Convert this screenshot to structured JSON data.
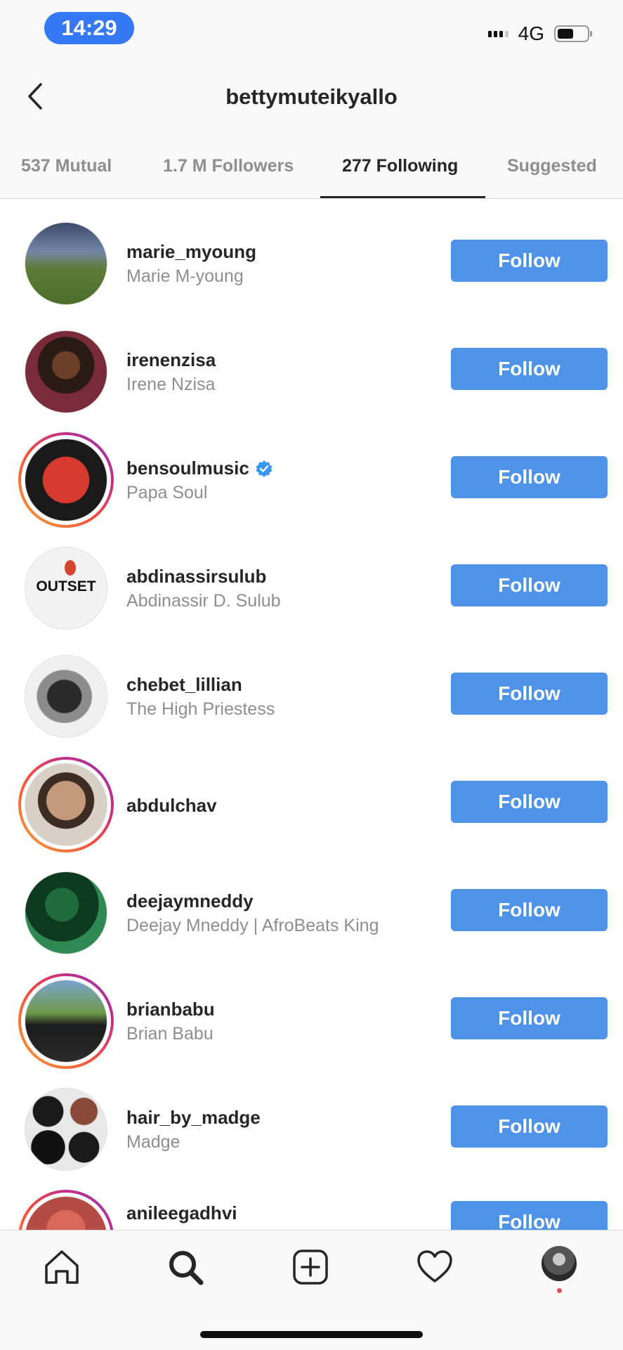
{
  "status_bar": {
    "time": "14:29",
    "network": "4G"
  },
  "header": {
    "title": "bettymuteikyallo"
  },
  "tabs": [
    {
      "label": "537 Mutual"
    },
    {
      "label": "1.7 M Followers"
    },
    {
      "label": "277 Following"
    },
    {
      "label": "Suggested"
    }
  ],
  "follow_label": "Follow",
  "accounts": [
    {
      "handle": "marie_myoung",
      "name": "Marie M-young",
      "verified": false,
      "story_ring": false
    },
    {
      "handle": "irenenzisa",
      "name": "Irene Nzisa",
      "verified": false,
      "story_ring": false
    },
    {
      "handle": "bensoulmusic",
      "name": "Papa Soul",
      "verified": true,
      "story_ring": true
    },
    {
      "handle": "abdinassirsulub",
      "name": "Abdinassir D. Sulub",
      "verified": false,
      "story_ring": false,
      "avatar_text": "OUTSET"
    },
    {
      "handle": "chebet_lillian",
      "name": "The High Priestess",
      "verified": false,
      "story_ring": false
    },
    {
      "handle": "abdulchav",
      "name": "",
      "verified": false,
      "story_ring": true
    },
    {
      "handle": "deejaymneddy",
      "name": "Deejay Mneddy | AfroBeats King",
      "verified": false,
      "story_ring": false
    },
    {
      "handle": "brianbabu",
      "name": "Brian Babu",
      "verified": false,
      "story_ring": true
    },
    {
      "handle": "hair_by_madge",
      "name": "Madge",
      "verified": false,
      "story_ring": false
    },
    {
      "handle": "anileegadhvi",
      "name": "",
      "verified": false,
      "story_ring": true
    }
  ],
  "colors": {
    "follow_button": "#4f93e8",
    "time_pill": "#3478f6",
    "text_primary": "#262626",
    "text_secondary": "#8e8e8e"
  }
}
